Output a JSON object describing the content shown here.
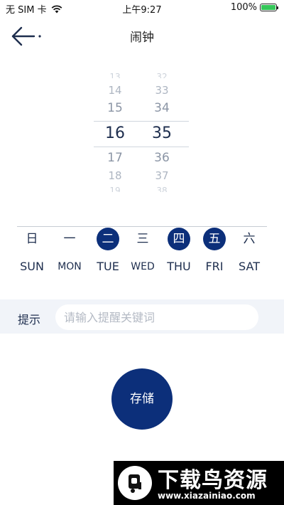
{
  "status_bar": {
    "carrier": "无 SIM 卡",
    "time": "上午9:27",
    "battery_text": "100%",
    "battery_level": 1.0,
    "wifi_icon": "wifi-icon"
  },
  "nav": {
    "back_icon": "back-arrow-icon",
    "title": "闹钟"
  },
  "picker": {
    "hours": [
      "13",
      "14",
      "15",
      "16",
      "17",
      "18",
      "19"
    ],
    "minutes": [
      "32",
      "33",
      "34",
      "35",
      "36",
      "37",
      "38"
    ],
    "selected_hour": "16",
    "selected_minute": "35"
  },
  "weekdays": [
    {
      "cn": "日",
      "en": "SUN",
      "selected": false
    },
    {
      "cn": "一",
      "en": "MON",
      "selected": false
    },
    {
      "cn": "二",
      "en": "TUE",
      "selected": true
    },
    {
      "cn": "三",
      "en": "WED",
      "selected": false
    },
    {
      "cn": "四",
      "en": "THU",
      "selected": true
    },
    {
      "cn": "五",
      "en": "FRI",
      "selected": true
    },
    {
      "cn": "六",
      "en": "SAT",
      "selected": false
    }
  ],
  "reminder": {
    "label": "提示",
    "placeholder": "请输入提醒关键词",
    "value": ""
  },
  "save_label": "存储",
  "watermark": {
    "title": "下载鸟资源",
    "url": "www.xiazainiao.com"
  },
  "colors": {
    "accent": "#0c2f7a",
    "input_bar_bg": "#f1f4f9",
    "battery": "#35c759"
  }
}
